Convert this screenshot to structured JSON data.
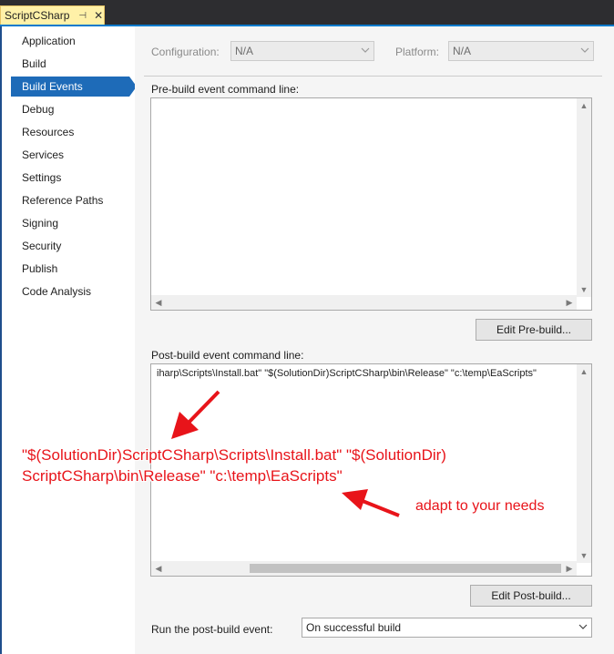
{
  "tab": {
    "title": "ScriptCSharp",
    "pin_glyph": "⊣",
    "close_glyph": "✕"
  },
  "nav": {
    "items": [
      {
        "label": "Application"
      },
      {
        "label": "Build"
      },
      {
        "label": "Build Events",
        "active": true
      },
      {
        "label": "Debug"
      },
      {
        "label": "Resources"
      },
      {
        "label": "Services"
      },
      {
        "label": "Settings"
      },
      {
        "label": "Reference Paths"
      },
      {
        "label": "Signing"
      },
      {
        "label": "Security"
      },
      {
        "label": "Publish"
      },
      {
        "label": "Code Analysis"
      }
    ]
  },
  "config": {
    "configuration_label": "Configuration:",
    "configuration_value": "N/A",
    "platform_label": "Platform:",
    "platform_value": "N/A"
  },
  "prebuild": {
    "label": "Pre-build event command line:",
    "value": "",
    "edit_button": "Edit Pre-build..."
  },
  "postbuild": {
    "label": "Post-build event command line:",
    "value": "iharp\\Scripts\\Install.bat\" \"$(SolutionDir)ScriptCSharp\\bin\\Release\" \"c:\\temp\\EaScripts\"",
    "edit_button": "Edit Post-build..."
  },
  "run": {
    "label": "Run the post-build event:",
    "value": "On successful build"
  },
  "annotations": {
    "command_line1": "\"$(SolutionDir)ScriptCSharp\\Scripts\\Install.bat\" \"$(SolutionDir)",
    "command_line2": "ScriptCSharp\\bin\\Release\" \"c:\\temp\\EaScripts\"",
    "hint": "adapt to your needs",
    "color": "#e8141a"
  }
}
